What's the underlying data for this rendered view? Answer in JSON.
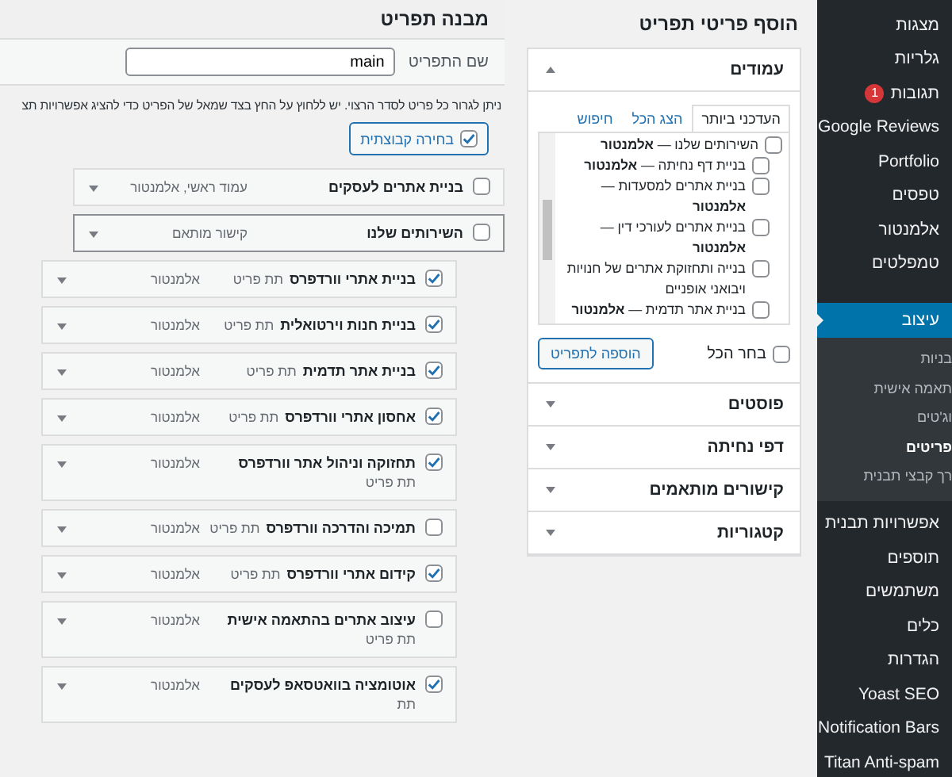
{
  "sidebar": {
    "items": [
      {
        "label": "מצגות",
        "selected": false
      },
      {
        "label": "גלריות",
        "selected": false
      },
      {
        "label": "תגובות",
        "badge": "1",
        "selected": false
      },
      {
        "label": "Google Reviews",
        "selected": false
      },
      {
        "label": "Portfolio",
        "selected": false
      },
      {
        "label": "טפסים",
        "selected": false
      },
      {
        "label": "אלמנטור",
        "selected": false
      },
      {
        "label": "טמפלטים",
        "selected": false
      },
      {
        "label": "עיצוב",
        "selected": true,
        "children": [
          {
            "label": "בניות",
            "selected": false
          },
          {
            "label": "תאמה אישית",
            "selected": false
          },
          {
            "label": "וג'טים",
            "selected": false
          },
          {
            "label": "פריטים",
            "selected": true
          },
          {
            "label": "רך קבצי תבנית",
            "selected": false
          }
        ]
      },
      {
        "label": "אפשרויות תבנית",
        "selected": false
      },
      {
        "label": "תוספים",
        "selected": false
      },
      {
        "label": "משתמשים",
        "selected": false
      },
      {
        "label": "כלים",
        "selected": false
      },
      {
        "label": "הגדרות",
        "selected": false
      },
      {
        "label": "Yoast SEO",
        "selected": false
      },
      {
        "label": "Notification Bars",
        "selected": false
      },
      {
        "label": "Titan Anti-spam",
        "selected": false
      }
    ]
  },
  "add_items": {
    "title": "הוסף פריטי תפריט",
    "sections": [
      {
        "title": "עמודים",
        "expanded": true,
        "tabs": [
          {
            "label": "העדכני ביותר",
            "selected": true
          },
          {
            "label": "הצג הכל",
            "selected": false
          },
          {
            "label": "חיפוש",
            "selected": false
          }
        ],
        "items": [
          {
            "label": "השירותים שלנו — **אלמנטור**",
            "checked": false,
            "children": [
              {
                "label": "בניית דף נחיתה — **אלמנטור**",
                "checked": false
              },
              {
                "label": "בניית אתרים למסעדות — **אלמנטור**",
                "checked": false
              },
              {
                "label": "בניית אתרים לעורכי דין — **אלמנטור**",
                "checked": false
              },
              {
                "label": "בנייה ותחזוקת אתרים של חנויות ויבואני אופניים",
                "checked": false
              },
              {
                "label": "בניית אתר תדמית — **אלמנטור**",
                "checked": false
              }
            ]
          }
        ],
        "select_all": {
          "label": "בחר הכל",
          "checked": false
        },
        "add_button": "הוספה לתפריט"
      },
      {
        "title": "פוסטים",
        "expanded": false
      },
      {
        "title": "דפי נחיתה",
        "expanded": false
      },
      {
        "title": "קישורים מותאמים",
        "expanded": false
      },
      {
        "title": "קטגוריות",
        "expanded": false
      }
    ]
  },
  "structure": {
    "title": "מבנה תפריט",
    "name_label": "שם התפריט",
    "name_value": "main",
    "instructions": "ניתן לגרור כל פריט לסדר הרצוי. יש ללחוץ על החץ בצד שמאל של הפריט כדי להציג אפשרויות תצ",
    "bulk_select": {
      "label": "בחירה קבוצתית",
      "checked": true
    },
    "items": [
      {
        "title": "בניית אתרים לעסקים",
        "type": "עמוד ראשי, אלמנטור",
        "checked": false,
        "active": false
      },
      {
        "title": "השירותים שלנו",
        "type": "קישור מותאם",
        "checked": false,
        "active": true,
        "children": [
          {
            "title": "בניית אתרי וורדפרס",
            "sublabel": "תת פריט",
            "type": "אלמנטור",
            "checked": true,
            "active": false
          },
          {
            "title": "בניית חנות וירטואלית",
            "sublabel": "תת פריט",
            "type": "אלמנטור",
            "checked": true,
            "active": false
          },
          {
            "title": "בניית אתר תדמית",
            "sublabel": "תת פריט",
            "type": "אלמנטור",
            "checked": true,
            "active": false
          },
          {
            "title": "אחסון אתרי וורדפרס",
            "sublabel": "תת פריט",
            "type": "אלמנטור",
            "checked": true,
            "active": false
          },
          {
            "title": "תחזוקה וניהול אתר וורדפרס",
            "sublabel": "תת פריט",
            "type": "אלמנטור",
            "checked": true,
            "active": false
          },
          {
            "title": "תמיכה והדרכה וורדפרס",
            "sublabel": "תת פריט",
            "type": "אלמנטור",
            "checked": false,
            "active": false
          },
          {
            "title": "קידום אתרי וורדפרס",
            "sublabel": "תת פריט",
            "type": "אלמנטור",
            "checked": true,
            "active": false
          },
          {
            "title": "עיצוב אתרים בהתאמה אישית",
            "sublabel": "תת פריט",
            "type": "אלמנטור",
            "checked": false,
            "active": false
          },
          {
            "title": "אוטומציה בוואטסאפ לעסקים",
            "sublabel": "תת",
            "type": "אלמנטור",
            "checked": true,
            "active": false
          }
        ]
      }
    ]
  }
}
